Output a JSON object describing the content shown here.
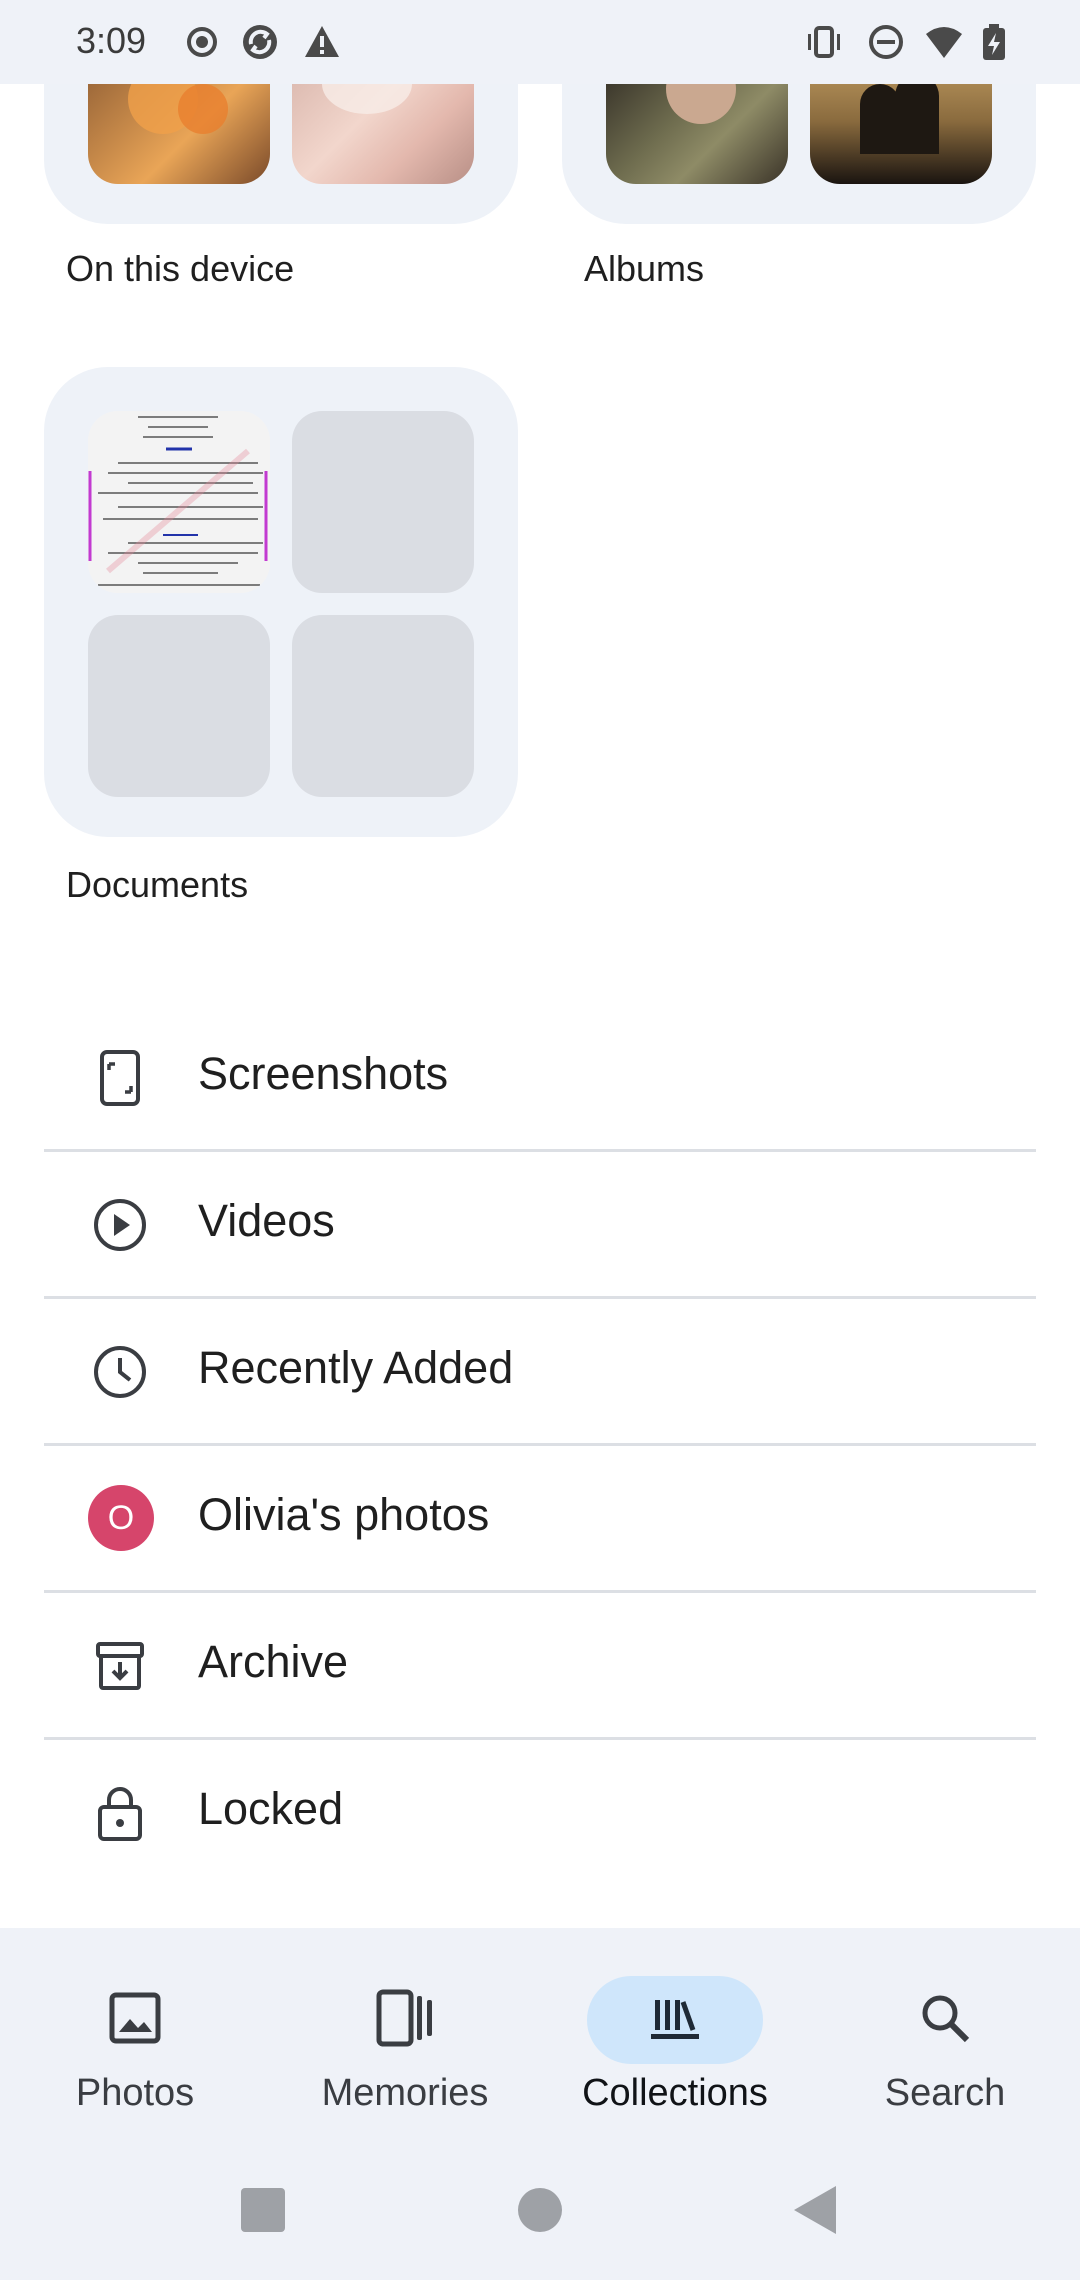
{
  "status_bar": {
    "time": "3:09",
    "left_icons": [
      "record-icon",
      "app-sync-icon",
      "warning-icon"
    ],
    "right_icons": [
      "vibrate-icon",
      "do-not-disturb-icon",
      "wifi-icon",
      "battery-charging-icon"
    ]
  },
  "collections": {
    "cards": [
      {
        "label": "On this device"
      },
      {
        "label": "Albums"
      },
      {
        "label": "Documents"
      }
    ],
    "list": [
      {
        "label": "Screenshots",
        "icon": "screenshot-icon"
      },
      {
        "label": "Videos",
        "icon": "play-circle-icon"
      },
      {
        "label": "Recently Added",
        "icon": "clock-icon"
      },
      {
        "label": "Olivia's photos",
        "icon": "avatar",
        "avatar_letter": "O",
        "avatar_color": "#d6456b"
      },
      {
        "label": "Archive",
        "icon": "archive-icon"
      },
      {
        "label": "Locked",
        "icon": "lock-icon"
      }
    ]
  },
  "bottom_nav": {
    "items": [
      {
        "label": "Photos",
        "icon": "photo-icon",
        "active": false
      },
      {
        "label": "Memories",
        "icon": "memories-icon",
        "active": false
      },
      {
        "label": "Collections",
        "icon": "collections-icon",
        "active": true
      },
      {
        "label": "Search",
        "icon": "search-icon",
        "active": false
      }
    ],
    "active_color": "#cfe6fb"
  },
  "system_nav": [
    "recents-button",
    "home-button",
    "back-button"
  ]
}
